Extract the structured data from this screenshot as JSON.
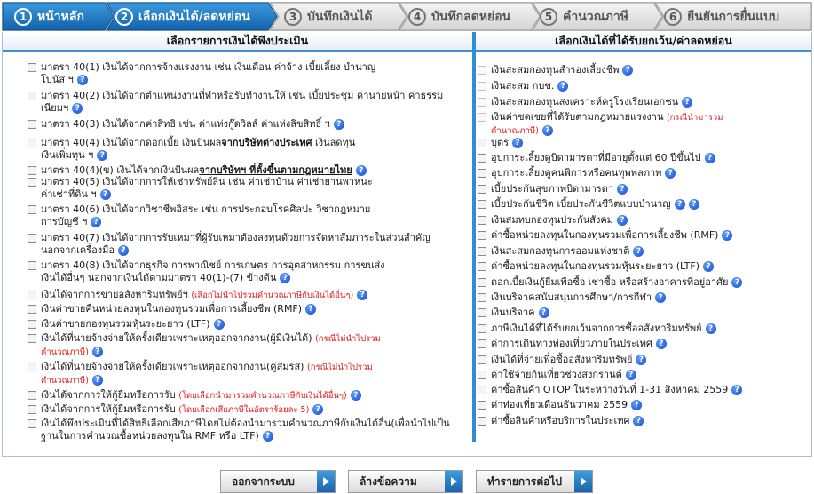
{
  "steps": [
    {
      "num": "1",
      "label": "หน้าหลัก",
      "active": true
    },
    {
      "num": "2",
      "label": "เลือกเงินได้/ลดหย่อน",
      "active": true
    },
    {
      "num": "3",
      "label": "บันทึกเงินได้",
      "active": false
    },
    {
      "num": "4",
      "label": "บันทึกลดหย่อน",
      "active": false
    },
    {
      "num": "5",
      "label": "คำนวณภาษี",
      "active": false
    },
    {
      "num": "6",
      "label": "ยืนยันการยื่นแบบ",
      "active": false
    }
  ],
  "left": {
    "header": "เลือกรายการเงินได้พึงประเมิน",
    "items": [
      {
        "lines": [
          "มาตรา 40(1) เงินได้จากการจ้างแรงงาน เช่น เงินเดือน ค่าจ้าง เบี้ยเลี้ยง บำนาญ",
          "โบนัส ฯ"
        ],
        "help": "?"
      },
      {
        "lines": [
          "มาตรา 40(2) เงินได้จากตำแหน่งงานที่ทำหรือรับทำงานให้ เช่น เบี้ยประชุม ค่านายหน้า ค่าธรรม",
          "เนียมฯ"
        ],
        "help": "?"
      },
      {
        "lines": [
          "มาตรา 40(3) เงินได้จากค่าสิทธิ เช่น ค่าแห่งกู๊ดวิลล์ ค่าแห่งลิขสิทธิ์ ฯ"
        ],
        "help": "?"
      },
      {
        "pre": "มาตรา 40(4) เงินได้จากดอกเบี้ย เงินปันผล",
        "under": "จากบริษัทต่างประเทศ",
        "post": " เงินลดทุน",
        "line2": "เงินเพิ่มทุน ฯ",
        "help": "?"
      },
      {
        "pre": "มาตรา 40(4)(ข) เงินได้จากเงินปันผล",
        "under": "จากบริษัทฯ ที่ตั้งขึ้นตามกฎหมายไทย",
        "help": "?"
      },
      {
        "lines": [
          "มาตรา 40(5) เงินได้จากการให้เช่าทรัพย์สิน เช่น ค่าเช่าบ้าน ค่าเช่ายานพาหนะ",
          "ค่าเช่าที่ดิน ฯ"
        ],
        "help": "?"
      },
      {
        "lines": [
          "มาตรา 40(6) เงินได้จากวิชาชีพอิสระ เช่น การประกอบโรคศิลปะ วิชากฎหมาย",
          "การบัญชี ฯ"
        ],
        "help": "?"
      },
      {
        "lines": [
          "มาตรา 40(7) เงินได้จากการรับเหมาที่ผู้รับเหมาต้องลงทุนด้วยการจัดหาสัมภาระในส่วนสำคัญ",
          "นอกจากเครื่องมือ"
        ],
        "help": "?"
      },
      {
        "lines": [
          "มาตรา 40(8) เงินได้จากธุรกิจ การพาณิชย์ การเกษตร การอุตสาหกรรม การขนส่ง",
          "เงินได้อื่นๆ นอกจากเงินได้ตามมาตรา 40(1)-(7) ข้างต้น"
        ],
        "help": "?"
      },
      {
        "main": "เงินได้จากการขายอสังหาริมทรัพย์ฯ",
        "note": "(เลือกไม่นำไปรวมคำนวณภาษีกับเงินได้อื่นๆ)",
        "help": "?"
      },
      {
        "main": "เงินค่าขายคืนหน่วยลงทุนในกองทุนรวมเพื่อการเลี้ยงชีพ (RMF)",
        "help": "?"
      },
      {
        "main": "เงินค่าขายกองทุนรวมหุ้นระยะยาว (LTF)",
        "help": "?"
      },
      {
        "main": "เงินได้ที่นายจ้างจ่ายให้ครั้งเดียวเพราะเหตุออกจากงาน(ผู้มีเงินได้)",
        "note": "(กรณีไม่นำไปรวม",
        "note2": "คำนวณภาษี)",
        "help": "?"
      },
      {
        "main": "เงินได้ที่นายจ้างจ่ายให้ครั้งเดียวเพราะเหตุออกจากงาน(คู่สมรส)",
        "note": "(กรณีไม่นำไปรวม",
        "note2": "คำนวณภาษี)",
        "help": "?"
      },
      {
        "main": "เงินได้จากการให้กู้ยืมหรือการรับ",
        "note": "(โดยเลือกนำมารวมคำนวณภาษีกับเงินได้อื่นๆ)",
        "help": "?"
      },
      {
        "main": "เงินได้จากการให้กู้ยืมหรือการรับ",
        "note": "(โดยเลือกเสียภาษีในอัตราร้อยละ 5)",
        "help": "?"
      },
      {
        "lines": [
          "เงินได้พึงประเมินที่ได้สิทธิเลือกเสียภาษีโดยไม่ต้องนำมารวมคำนวณภาษีกับเงินได้อื่น(เพื่อนำไปเป็น",
          "ฐานในการคำนวณซื้อหน่วยลงทุนใน RMF หรือ LTF)"
        ],
        "help": "?"
      }
    ]
  },
  "right": {
    "header": "เลือกเงินได้ที่ได้รับยกเว้น/ค่าลดหย่อน",
    "items": [
      {
        "main": "เงินสะสมกองทุนสำรองเลี้ยงชีพ",
        "help": "?",
        "enabled": false
      },
      {
        "main": "เงินสะสม กบข.",
        "help": "?",
        "enabled": false
      },
      {
        "main": "เงินสะสมกองทุนสงเคราะห์ครูโรงเรียนเอกชน",
        "help": "?",
        "enabled": false
      },
      {
        "main": "เงินค่าชดเชยที่ได้รับตามกฎหมายแรงงาน",
        "note": "(กรณีนำมารวม",
        "note2": "คำนวณภาษี)",
        "help": "?",
        "enabled": false
      },
      {
        "main": "บุตร",
        "help": "?",
        "enabled": true
      },
      {
        "main": "อุปการะเลี้ยงดูบิดามารดาที่มีอายุตั้งแต่ 60 ปีขึ้นไป",
        "help": "?",
        "enabled": true
      },
      {
        "main": "อุปการะเลี้ยงดูคนพิการหรือคนทุพพลภาพ",
        "help": "?",
        "enabled": true
      },
      {
        "main": "เบี้ยประกันสุขภาพบิดามารดา",
        "help": "?",
        "enabled": true
      },
      {
        "main": "เบี้ยประกันชีวิต เบี้ยประกันชีวิตแบบบำนาญ",
        "help": "?",
        "help2": "?",
        "enabled": true
      },
      {
        "main": "เงินสมทบกองทุนประกันสังคม",
        "help": "?",
        "enabled": true
      },
      {
        "main": "ค่าซื้อหน่วยลงทุนในกองทุนรวมเพื่อการเลี้ยงชีพ (RMF)",
        "help": "?",
        "enabled": true
      },
      {
        "main": "เงินสะสมกองทุนการออมแห่งชาติ",
        "help": "?",
        "enabled": true
      },
      {
        "main": "ค่าซื้อหน่วยลงทุนในกองทุนรวมหุ้นระยะยาว (LTF)",
        "help": "?",
        "enabled": true
      },
      {
        "main": "ดอกเบี้ยเงินกู้ยืมเพื่อซื้อ เช่าซื้อ หรือสร้างอาคารที่อยู่อาศัย",
        "help": "?",
        "enabled": true
      },
      {
        "main": "เงินบริจาคสนับสนุนการศึกษา/การกีฬา",
        "help": "?",
        "enabled": true
      },
      {
        "main": "เงินบริจาค",
        "help": "?",
        "enabled": true
      },
      {
        "main": "ภาษีเงินได้ที่ได้รับยกเว้นจากการซื้ออสังหาริมทรัพย์",
        "help": "?",
        "enabled": true
      },
      {
        "main": "ค่าการเดินทางท่องเที่ยวภายในประเทศ",
        "help": "?",
        "enabled": true
      },
      {
        "main": "เงินได้ที่จ่ายเพื่อซื้ออสังหาริมทรัพย์",
        "help": "?",
        "enabled": true
      },
      {
        "main": "ค่าใช้จ่ายกินเที่ยวช่วงสงกรานต์",
        "help": "?",
        "enabled": true
      },
      {
        "main": "ค่าซื้อสินค้า OTOP ในระหว่างวันที่ 1-31 สิงหาคม 2559",
        "help": "?",
        "enabled": true
      },
      {
        "main": "ค่าท่องเที่ยวเดือนธันวาคม 2559",
        "help": "?",
        "enabled": true
      },
      {
        "main": "ค่าซื้อสินค้าหรือบริการในประเทศ",
        "help": "?",
        "enabled": true
      }
    ]
  },
  "buttons": {
    "exit": "ออกจากระบบ",
    "clear": "ล้างข้อความ",
    "next": "ทำรายการต่อไป"
  },
  "colors": {
    "active_step": "#1c6fb8",
    "inactive_step": "#d0d0d0",
    "accent": "#2d8ed6",
    "note": "#e01b1b"
  }
}
